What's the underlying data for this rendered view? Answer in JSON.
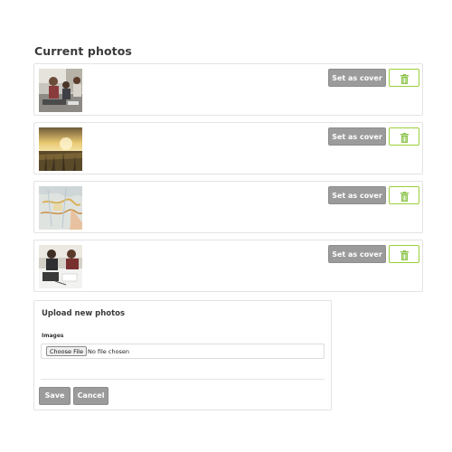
{
  "current_photos": {
    "title": "Current photos",
    "photos": [
      {
        "cover_label": "Set as cover",
        "delete_icon": "trash-icon",
        "thumbnail": "people-meeting"
      },
      {
        "cover_label": "Set as cover",
        "delete_icon": "trash-icon",
        "thumbnail": "sunset-field"
      },
      {
        "cover_label": "Set as cover",
        "delete_icon": "trash-icon",
        "thumbnail": "map"
      },
      {
        "cover_label": "Set as cover",
        "delete_icon": "trash-icon",
        "thumbnail": "people-working"
      }
    ]
  },
  "upload": {
    "title": "Upload new photos",
    "images_label": "Images",
    "choose_file_label": "Choose File",
    "file_status": "No file chosen",
    "save_label": "Save",
    "cancel_label": "Cancel"
  },
  "colors": {
    "button_gray": "#9b9b9b",
    "delete_border": "#9bcf3a",
    "trash_green": "#8bc34a"
  }
}
